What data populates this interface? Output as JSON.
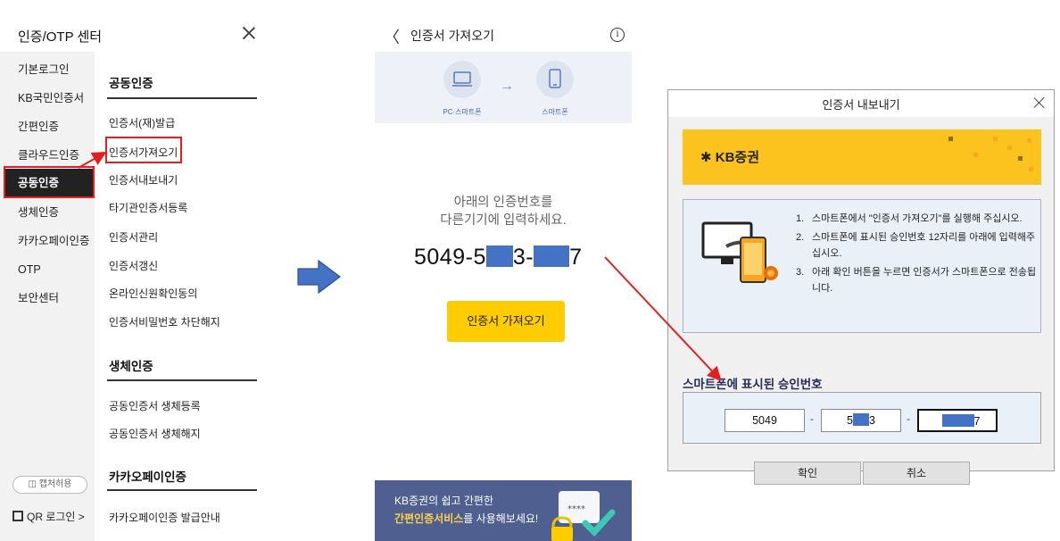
{
  "menu": {
    "title": "인증/OTP 센터",
    "side_items": [
      "기본로그인",
      "KB국민인증서",
      "간편인증",
      "클라우드인증",
      "공동인증",
      "생체인증",
      "카카오페이인증",
      "OTP",
      "보안센터"
    ],
    "active_side_item": "공동인증",
    "capture_label": "캡처허용",
    "qr_login_label": "QR 로그인 >",
    "sections": [
      {
        "title": "공동인증",
        "items": [
          "인증서(재)발급",
          "인증서가져오기",
          "인증서내보내기",
          "타기관인증서등록",
          "인증서관리",
          "인증서갱신",
          "온라인신원확인동의",
          "인증서비밀번호 차단해지"
        ]
      },
      {
        "title": "생체인증",
        "items": [
          "공동인증서 생체등록",
          "공동인증서 생체해지"
        ]
      },
      {
        "title": "카카오페이인증",
        "items": [
          "카카오페이인증 발급안내"
        ]
      }
    ],
    "highlighted_item": "인증서가져오기"
  },
  "phone": {
    "back_glyph": "〈",
    "title": "인증서 가져오기",
    "info_glyph": "i",
    "from_label": "PC·스마트폰",
    "to_label": "스마트폰",
    "arrow_glyph": "→",
    "instruction_line1": "아래의 인증번호를",
    "instruction_line2": "다른기기에 입력하세요.",
    "code_part1_prefix": "5049-5",
    "code_part2_suffix": "3-",
    "code_part3_suffix": "7",
    "button_label": "인증서 가져오기",
    "ad_line1": "KB증권의 쉽고 간편한",
    "ad_highlight": "간편인증서비스",
    "ad_line2_rest": "를 사용해보세요!",
    "ad_pin": "****"
  },
  "dialog": {
    "title": "인증서 내보내기",
    "brand": "KB증권",
    "steps": [
      {
        "num": "1.",
        "text": "스마트폰에서 \"인증서 가져오기\"를 실행해 주십시오."
      },
      {
        "num": "2.",
        "text": "스마트폰에 표시된 승인번호 12자리를 아래에 입력해주십시오."
      },
      {
        "num": "3.",
        "text": "아래 확인 버튼을 누르면 인증서가 스마트폰으로 전송됩니다."
      }
    ],
    "approval_label": "스마트폰에 표시된 승인번호",
    "field1": "5049",
    "field2_prefix": "5",
    "field2_suffix": "3",
    "field3_suffix": "7",
    "dash": "-",
    "ok_label": "확인",
    "cancel_label": "취소"
  },
  "colors": {
    "highlight_red": "#e41e1e",
    "mask_blue": "#4472c4",
    "kb_yellow": "#fcc31f",
    "button_yellow": "#ffcc00"
  }
}
